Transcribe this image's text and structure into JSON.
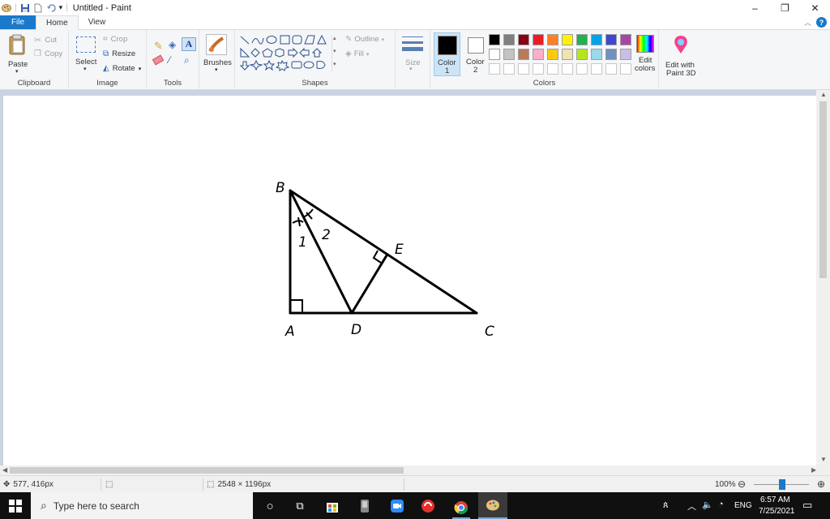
{
  "window": {
    "title": "Untitled - Paint",
    "minimize": "–",
    "maximize": "❐",
    "close": "✕"
  },
  "tabs": {
    "file": "File",
    "home": "Home",
    "view": "View"
  },
  "ribbon": {
    "clipboard": {
      "label": "Clipboard",
      "paste": "Paste",
      "cut": "Cut",
      "copy": "Copy"
    },
    "image": {
      "label": "Image",
      "select": "Select",
      "crop": "Crop",
      "resize": "Resize",
      "rotate": "Rotate"
    },
    "tools": {
      "label": "Tools"
    },
    "brushes": {
      "label": "Brushes"
    },
    "shapes": {
      "label": "Shapes",
      "outline": "Outline",
      "fill": "Fill"
    },
    "size": {
      "label": "Size"
    },
    "colors": {
      "label": "Colors",
      "color1": "Color",
      "color1_num": "1",
      "color2": "Color",
      "color2_num": "2",
      "edit_colors_1": "Edit",
      "edit_colors_2": "colors",
      "paint3d_1": "Edit with",
      "paint3d_2": "Paint 3D",
      "palette_row1": [
        "#000000",
        "#7f7f7f",
        "#880015",
        "#ed1c24",
        "#ff7f27",
        "#fff200",
        "#22b14c",
        "#00a2e8",
        "#3f48cc",
        "#a349a4"
      ],
      "palette_row2": [
        "#ffffff",
        "#c3c3c3",
        "#b97a57",
        "#ffaec9",
        "#ffc90e",
        "#efe4b0",
        "#b5e61d",
        "#99d9ea",
        "#7092be",
        "#c8bfe7"
      ]
    }
  },
  "figure": {
    "points": {
      "B": "B",
      "A": "A",
      "D": "D",
      "C": "C",
      "E": "E"
    },
    "angle1": "1",
    "angle2": "2"
  },
  "status": {
    "cursor": "577, 416px",
    "canvas_size": "2548 × 1196px",
    "zoom": "100%"
  },
  "taskbar": {
    "search_placeholder": "Type here to search",
    "language": "ENG",
    "time": "6:57 AM",
    "date": "7/25/2021"
  }
}
